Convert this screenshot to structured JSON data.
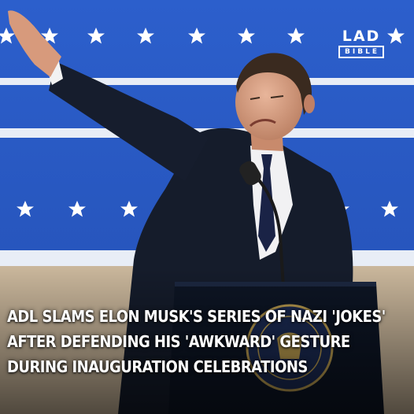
{
  "post": {
    "logo": {
      "top": "LAD",
      "bottom": "BIBLE"
    },
    "headline_lines": [
      "ADL SLAMS ELON MUSK'S SERIES OF NAZI 'JOKES'",
      "AFTER DEFENDING HIS 'AWKWARD' GESTURE",
      "DURING INAUGURATION CELEBRATIONS"
    ],
    "colors": {
      "backdrop_blue": "#2a5cc8",
      "stripe": "#e8edf6",
      "suit": "#151c2b",
      "podium": "#0d1524",
      "text": "#ffffff"
    },
    "icons": [
      "star-icon",
      "microphone-icon",
      "presidential-seal-icon"
    ]
  }
}
